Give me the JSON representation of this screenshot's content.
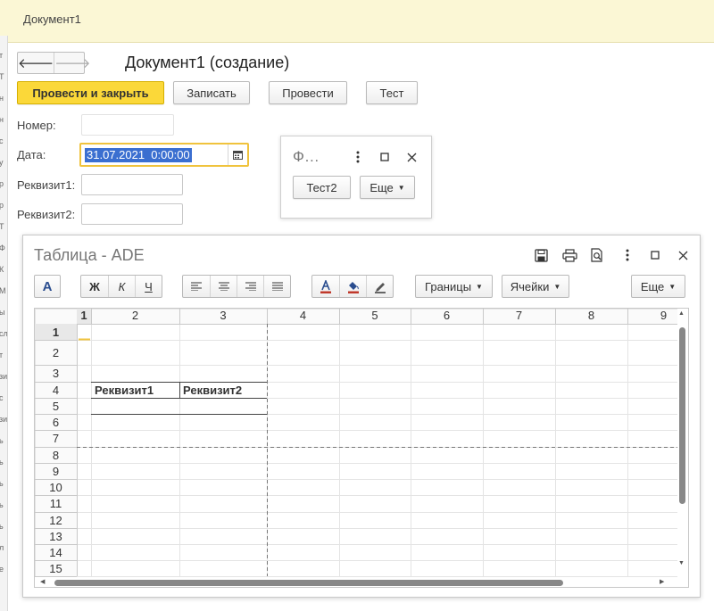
{
  "window": {
    "title": "Документ1"
  },
  "nav": {
    "back_glyph": "🡐",
    "forward_glyph": "🡒"
  },
  "form": {
    "title": "Документ1 (создание)",
    "buttons": {
      "post_close": "Провести и закрыть",
      "save": "Записать",
      "post": "Провести",
      "test": "Тест"
    },
    "fields": {
      "number_label": "Номер:",
      "number_value": "",
      "date_label": "Дата:",
      "date_value": "31.07.2021  0:00:00",
      "req1_label": "Реквизит1:",
      "req1_value": "",
      "req2_label": "Реквизит2:",
      "req2_value": ""
    }
  },
  "popup": {
    "title": "Ф…",
    "buttons": {
      "test2": "Тест2",
      "more": "Еще"
    }
  },
  "table_window": {
    "title": "Таблица - ADE",
    "toolbar": {
      "font_a": "A",
      "bold": "Ж",
      "italic": "К",
      "underline": "Ч",
      "borders": "Границы",
      "cells": "Ячейки",
      "more": "Еще",
      "text_color_hex": "#c0392b",
      "fill_color_hex": "#c0392b",
      "font_button_color": "#2a4d8f"
    },
    "sheet": {
      "columns": [
        "1",
        "2",
        "3",
        "4",
        "5",
        "6",
        "7",
        "8",
        "9"
      ],
      "rows": [
        "1",
        "2",
        "3",
        "4",
        "5",
        "6",
        "7",
        "8",
        "9",
        "10",
        "11",
        "12",
        "13",
        "14",
        "15"
      ],
      "cells": {
        "r4c2": "Реквизит1",
        "r4c3": "Реквизит2"
      },
      "active_cell": "R1C1"
    }
  },
  "colors": {
    "header_bg": "#fbf7d5",
    "primary_button": "#fbd839",
    "selection": "#3b6fd0",
    "focus_border": "#f0c33d"
  },
  "left_strip_chars": [
    "т",
    "Т",
    "н",
    "н",
    "с",
    "у",
    "р",
    "р",
    "Т",
    "Ф",
    "К",
    "М",
    "ы",
    "сл",
    "т",
    "зи",
    "с",
    "зи",
    "ь",
    "ь",
    "ь",
    "ь",
    "ь",
    "л",
    "е"
  ]
}
